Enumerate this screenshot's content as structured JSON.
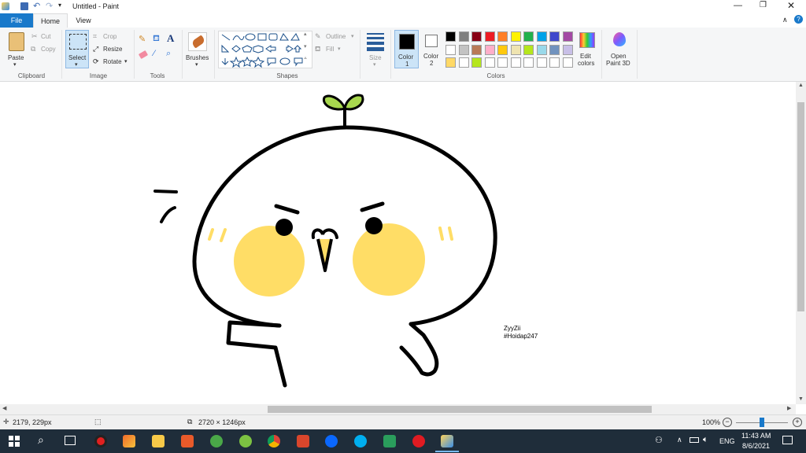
{
  "title_bar": {
    "title": "Untitled - Paint",
    "minimize_icon": "minimize-icon",
    "maximize_icon": "restore-icon",
    "close_icon": "close-icon"
  },
  "tabs": {
    "file": "File",
    "home": "Home",
    "view": "View"
  },
  "ribbon": {
    "clipboard": {
      "paste": "Paste",
      "cut": "Cut",
      "copy": "Copy",
      "label": "Clipboard"
    },
    "image": {
      "select": "Select",
      "crop": "Crop",
      "resize": "Resize",
      "rotate": "Rotate",
      "label": "Image"
    },
    "tools": {
      "label": "Tools"
    },
    "brushes": {
      "label": "Brushes"
    },
    "shapes": {
      "outline": "Outline",
      "fill": "Fill",
      "label": "Shapes"
    },
    "size": {
      "label": "Size"
    },
    "colors": {
      "color1": "Color",
      "color1_num": "1",
      "color2": "Color",
      "color2_num": "2",
      "edit": "Edit",
      "edit2": "colors",
      "label": "Colors",
      "color1_value": "#000000",
      "color2_value": "#ffffff",
      "palette_row1": [
        "#000000",
        "#7f7f7f",
        "#880015",
        "#ed1c24",
        "#ff7f27",
        "#fff200",
        "#22b14c",
        "#00a2e8",
        "#3f48cc",
        "#a349a4"
      ],
      "palette_row2": [
        "#ffffff",
        "#c3c3c3",
        "#b97a57",
        "#ffaec9",
        "#ffc90e",
        "#efe4b0",
        "#b5e61d",
        "#99d9ea",
        "#7092be",
        "#c8bfe7"
      ],
      "palette_row3": [
        "#ffd966",
        "#ffffff",
        "#b5e61d",
        "#ffffff",
        "#ffffff",
        "#ffffff",
        "#ffffff",
        "#ffffff",
        "#ffffff",
        "#ffffff"
      ]
    },
    "paint3d": {
      "line1": "Open",
      "line2": "Paint 3D"
    }
  },
  "drawing": {
    "signature_line1": "ZyyZii",
    "signature_line2": "#Hoidap247",
    "stroke_color": "#000000",
    "cheek_color": "#ffdd66",
    "sprout_color": "#a8d84e"
  },
  "status": {
    "cursor_pos": "2179, 229px",
    "canvas_size": "2720 × 1246px",
    "zoom": "100%"
  },
  "taskbar": {
    "lang": "ENG",
    "time": "11:43 AM",
    "date": "8/6/2021"
  }
}
